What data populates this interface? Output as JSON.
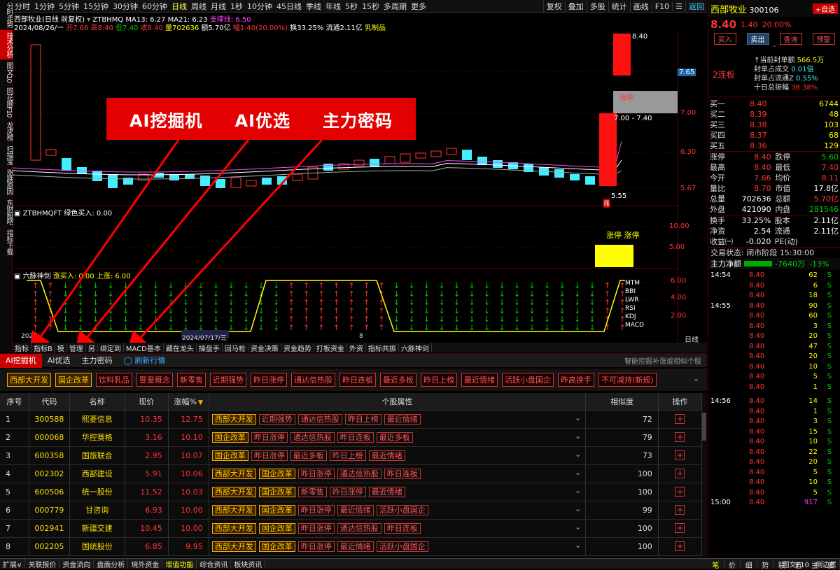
{
  "left_tabs": [
    "分时走势",
    "技术分析",
    "图文10",
    "同花顺F10",
    "龙虎榜",
    "扫描宝",
    "涨跌原因",
    "东财股吧",
    "指标下载"
  ],
  "toolbar": {
    "items": [
      "分时",
      "1分钟",
      "5分钟",
      "15分钟",
      "30分钟",
      "60分钟",
      "日线",
      "周线",
      "月线",
      "1秒",
      "10分钟",
      "45日线",
      "季线",
      "年线",
      "5秒",
      "15秒",
      "多周期",
      "更多"
    ],
    "active": "日线",
    "right": [
      "复权",
      "叠加",
      "多股",
      "统计",
      "画线",
      "F10",
      "☰",
      "返回"
    ]
  },
  "info": {
    "line1_name": "西部牧业(日线 前复权)",
    "line1_ind": "ZTBHMQ",
    "ma13": "MA13: 6.27",
    "ma21": "MA21: 6.23",
    "zc": "支撑线: 6.50",
    "line2": "2024/08/26/一",
    "open": "开7.66",
    "high": "高8.40",
    "low": "低7.40",
    "close": "收8.40",
    "vol": "量702636",
    "amt": "额5.70亿",
    "chg": "幅1.40(20.00%)",
    "turn": "换33.25%",
    "flow": "流通2.11亿",
    "sector": "乳制品"
  },
  "axis_main": [
    "7.65",
    "7.00",
    "6.30",
    "5.67"
  ],
  "main_labels": {
    "top": "8.40",
    "range": "7.00 - 7.40",
    "zt": "涨停",
    "low": "5.55",
    "zhang": "涨"
  },
  "pane2": {
    "title": "ZTBHMQFT",
    "sub": "绿色买入: 0.00",
    "axis": [
      "10.00",
      "5.00"
    ],
    "label": "涨停 涨停"
  },
  "pane3": {
    "title": "六脉神剑",
    "sub": "涨买入: 0.00 上涨: 6.00",
    "axis": [
      "6.00",
      "4.00",
      "2.00"
    ],
    "legend": [
      "MTM",
      "BBI",
      "LWR",
      "RSI",
      "KDJ",
      "MACD"
    ]
  },
  "date_labels": {
    "a": "2024/07/17/三",
    "b": "202",
    "c": "8",
    "period": "日线"
  },
  "overlay": [
    "AI挖掘机",
    "AI优选",
    "主力密码"
  ],
  "subtabs": [
    "指标",
    "指标B",
    "模",
    "管理",
    "另",
    "绑定到",
    "MACD基本",
    "藏在龙头",
    "操盘手",
    "回马枪",
    "资金决策",
    "资金趋势",
    "打板资金",
    "外资",
    "指标共振",
    "六脉神剑"
  ],
  "ai_tabs": [
    "AI挖掘机",
    "AI优选",
    "主力密码"
  ],
  "refresh": "刷新行情",
  "search_hint": "智能挖掘补涨或相似个股",
  "filters": [
    "西部大开发",
    "国企改革",
    "饮料乳品",
    "婴童概念",
    "新零售",
    "近期强势",
    "昨日涨停",
    "通达信热股",
    "昨日连板",
    "最近多板",
    "昨日上榜",
    "最近情绪",
    "活跃小盘国企",
    "昨高换手",
    "不可减持(新规)"
  ],
  "table": {
    "headers": [
      "序号",
      "代码",
      "名称",
      "现价",
      "涨幅%",
      "个股属性",
      "相似度",
      "操作"
    ],
    "rows": [
      {
        "i": "1",
        "code": "300588",
        "name": "熙菱信息",
        "price": "10.35",
        "pct": "12.75",
        "tags": [
          "西部大开发",
          "近期强势",
          "通达信热股",
          "昨日上榜",
          "最近情绪"
        ],
        "sim": "72"
      },
      {
        "i": "2",
        "code": "000068",
        "name": "华控赛格",
        "price": "3.16",
        "pct": "10.10",
        "tags": [
          "国企改革",
          "昨日涨停",
          "通达信热股",
          "昨日连板",
          "最近多板"
        ],
        "sim": "79"
      },
      {
        "i": "3",
        "code": "600358",
        "name": "国旅联合",
        "price": "2.95",
        "pct": "10.07",
        "tags": [
          "国企改革",
          "昨日涨停",
          "最近多板",
          "昨日上榜",
          "最近情绪"
        ],
        "sim": "73"
      },
      {
        "i": "4",
        "code": "002302",
        "name": "西部建设",
        "price": "5.91",
        "pct": "10.06",
        "tags": [
          "西部大开发",
          "国企改革",
          "昨日涨停",
          "通达信热股",
          "昨日连板"
        ],
        "sim": "100"
      },
      {
        "i": "5",
        "code": "600506",
        "name": "统一股份",
        "price": "11.52",
        "pct": "10.03",
        "tags": [
          "西部大开发",
          "国企改革",
          "新零售",
          "昨日涨停",
          "最近情绪"
        ],
        "sim": "100"
      },
      {
        "i": "6",
        "code": "000779",
        "name": "甘咨询",
        "price": "6.93",
        "pct": "10.00",
        "tags": [
          "西部大开发",
          "国企改革",
          "昨日涨停",
          "最近情绪",
          "活跃小盘国企"
        ],
        "sim": "99"
      },
      {
        "i": "7",
        "code": "002941",
        "name": "新疆交建",
        "price": "10.45",
        "pct": "10.00",
        "tags": [
          "西部大开发",
          "国企改革",
          "昨日涨停",
          "通达信热股",
          "昨日连板"
        ],
        "sim": "100"
      },
      {
        "i": "8",
        "code": "002205",
        "name": "国统股份",
        "price": "6.85",
        "pct": "9.95",
        "tags": [
          "西部大开发",
          "国企改革",
          "昨日涨停",
          "最近情绪",
          "活跃小盘国企"
        ],
        "sim": "100"
      }
    ]
  },
  "status": [
    "扩展∨",
    "关联报价",
    "资金流向",
    "盘面分析",
    "境外资金",
    "增值功能",
    "综合资讯",
    "板块资讯"
  ],
  "status_right": [
    "图文F10",
    "侧边栏"
  ],
  "right": {
    "name": "西部牧业",
    "code": "300106",
    "add": "+自选",
    "price": "8.40",
    "chg": "1.40",
    "pct": "20.00%",
    "btns": [
      "买入",
      "卖出",
      "查询",
      "预警"
    ],
    "seal": [
      [
        "当前封单额",
        "566.5万"
      ],
      [
        "封单占成交",
        "0.01倍"
      ],
      [
        "封单占流通Z",
        "0.55%"
      ],
      [
        "十日总振幅",
        "38.38%"
      ]
    ],
    "lianban": "2连板",
    "book": [
      [
        "买一",
        "8.40",
        "6744"
      ],
      [
        "买二",
        "8.39",
        "48"
      ],
      [
        "买三",
        "8.38",
        "103"
      ],
      [
        "买四",
        "8.37",
        "68"
      ],
      [
        "买五",
        "8.36",
        "129"
      ]
    ],
    "stats": [
      [
        "涨停",
        "8.40",
        "跌停",
        "5.60"
      ],
      [
        "最高",
        "8.40",
        "最低",
        "7.40"
      ],
      [
        "今开",
        "7.66",
        "均价",
        "8.11"
      ],
      [
        "量比",
        "8.70",
        "市值",
        "17.8亿"
      ],
      [
        "总量",
        "702636",
        "总额",
        "5.70亿"
      ],
      [
        "外盘",
        "421090",
        "内盘",
        "281546"
      ]
    ],
    "stats2": [
      [
        "换手",
        "33.25%",
        "股本",
        "2.11亿"
      ],
      [
        "净资",
        "2.54",
        "流通",
        "2.11亿"
      ],
      [
        "收益㈠",
        "-0.020",
        "PE(动)",
        ""
      ]
    ],
    "state": "交易状态: 闭市阶段 15:30:00",
    "netflow": [
      "主力净额",
      "-7640万",
      "-13%"
    ],
    "ticks": [
      [
        "14:54",
        "8.40",
        "62",
        "S"
      ],
      [
        "",
        "8.40",
        "6",
        "S"
      ],
      [
        "",
        "8.40",
        "18",
        "S"
      ],
      [
        "14:55",
        "8.40",
        "90",
        "S"
      ],
      [
        "",
        "8.40",
        "60",
        "S"
      ],
      [
        "",
        "8.40",
        "3",
        "S"
      ],
      [
        "",
        "8.40",
        "20",
        "S"
      ],
      [
        "",
        "8.40",
        "47",
        "S"
      ],
      [
        "",
        "8.40",
        "20",
        "S"
      ],
      [
        "",
        "8.40",
        "10",
        "S"
      ],
      [
        "",
        "8.40",
        "5",
        "S"
      ],
      [
        "",
        "8.40",
        "1",
        "S"
      ],
      [
        "14:56",
        "8.40",
        "14",
        "S"
      ],
      [
        "",
        "8.40",
        "1",
        "S"
      ],
      [
        "",
        "8.40",
        "3",
        "S"
      ],
      [
        "",
        "8.40",
        "15",
        "S"
      ],
      [
        "",
        "8.40",
        "10",
        "S"
      ],
      [
        "",
        "8.40",
        "22",
        "S"
      ],
      [
        "",
        "8.40",
        "20",
        "S"
      ],
      [
        "",
        "8.40",
        "5",
        "S"
      ],
      [
        "",
        "8.40",
        "10",
        "S"
      ],
      [
        "",
        "8.40",
        "5",
        "S"
      ],
      [
        "15:00",
        "8.40",
        "917",
        "S"
      ]
    ],
    "bottom": [
      "笔",
      "价",
      "细",
      "势",
      "联",
      "值",
      "主",
      "婆"
    ]
  }
}
